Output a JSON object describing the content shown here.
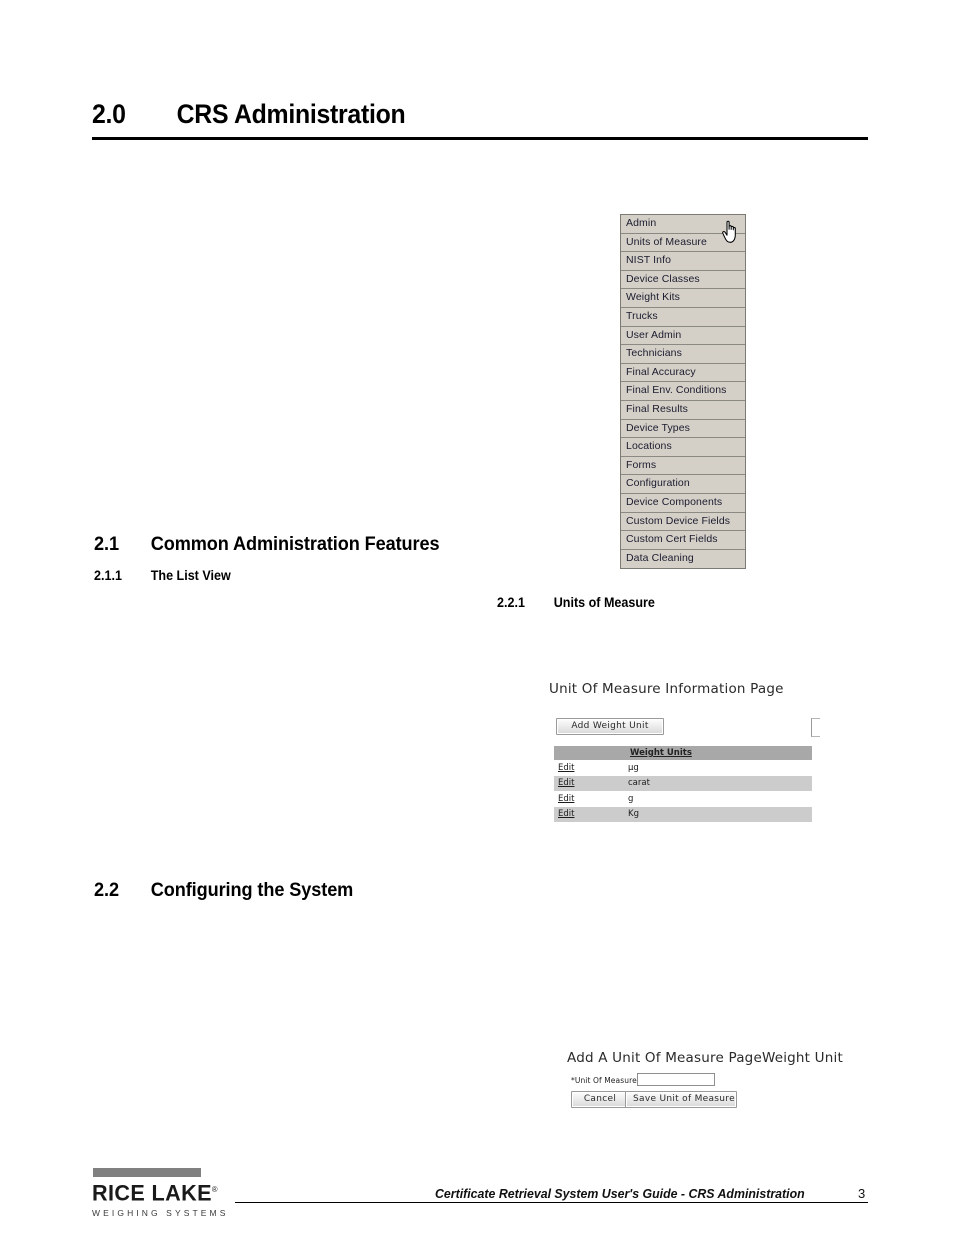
{
  "document": {
    "chapter_number": "2.0",
    "chapter_title": "CRS Administration"
  },
  "sections": {
    "s21_num": "2.1",
    "s21_title": "Common Administration Features",
    "s211_num": "2.1.1",
    "s211_title": "The List View",
    "s221_num": "2.2.1",
    "s221_title": "Units of Measure",
    "s22_num": "2.2",
    "s22_title": "Configuring the System"
  },
  "admin_menu": {
    "items": [
      {
        "label": "Admin"
      },
      {
        "label": "Units of Measure"
      },
      {
        "label": "NIST Info"
      },
      {
        "label": "Device Classes"
      },
      {
        "label": "Weight Kits"
      },
      {
        "label": "Trucks"
      },
      {
        "label": "User Admin"
      },
      {
        "label": "Technicians"
      },
      {
        "label": "Final Accuracy"
      },
      {
        "label": "Final Env. Conditions"
      },
      {
        "label": "Final Results"
      },
      {
        "label": "Device Types"
      },
      {
        "label": "Locations"
      },
      {
        "label": "Forms"
      },
      {
        "label": "Configuration"
      },
      {
        "label": "Device Components"
      },
      {
        "label": "Custom Device Fields"
      },
      {
        "label": "Custom Cert Fields"
      },
      {
        "label": "Data Cleaning"
      }
    ],
    "cursor": "pointing-hand-cursor"
  },
  "uom_info_page": {
    "title": "Unit Of Measure Information Page",
    "add_button_label": "Add Weight Unit",
    "table": {
      "columns": [
        "",
        "Weight Units"
      ],
      "edit_label": "Edit",
      "rows": [
        {
          "edit": "Edit",
          "unit": "µg"
        },
        {
          "edit": "Edit",
          "unit": "carat"
        },
        {
          "edit": "Edit",
          "unit": "g"
        },
        {
          "edit": "Edit",
          "unit": "Kg"
        }
      ]
    }
  },
  "uom_add_page": {
    "title": "Add A Unit Of Measure PageWeight Unit",
    "field_label": "*Unit Of Measure",
    "field_value": "",
    "field_placeholder": "",
    "cancel_label": "Cancel",
    "save_label": "Save Unit of Measure"
  },
  "footer": {
    "logo_name": "RICE LAKE",
    "logo_registered": "®",
    "logo_subtitle": "WEIGHING SYSTEMS",
    "text": "Certificate Retrieval System User's Guide - CRS Administration",
    "page_number": "3"
  },
  "colors": {
    "menu_bg": "#d4d0c8",
    "menu_border": "#7b7b73",
    "table_header_bg": "#a8a8a8",
    "table_alt_row_bg": "#cccccc",
    "logo_bar": "#808080"
  }
}
